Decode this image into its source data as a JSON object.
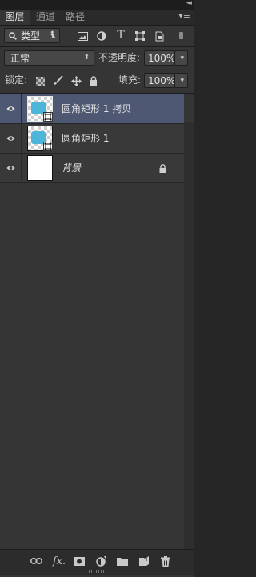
{
  "panel": {
    "tabs": [
      {
        "label": "图层",
        "active": true
      },
      {
        "label": "通道",
        "active": false
      },
      {
        "label": "路径",
        "active": false
      }
    ],
    "collapse_glyph": "◂◂",
    "menu_glyph": "▾≡"
  },
  "filter": {
    "kind_label": "类型",
    "icons": [
      "image-filter-icon",
      "adjustment-filter-icon",
      "text-filter-icon",
      "shape-filter-icon",
      "smart-object-filter-icon"
    ],
    "text_icon_glyph": "T"
  },
  "blend": {
    "mode": "正常",
    "opacity_label": "不透明度:",
    "opacity_value": "100%"
  },
  "lock": {
    "label": "锁定:",
    "fill_label": "填充:",
    "fill_value": "100%"
  },
  "layers": [
    {
      "name": "圆角矩形 1 拷贝",
      "type": "shape",
      "selected": true,
      "visible": true,
      "locked": false
    },
    {
      "name": "圆角矩形 1",
      "type": "shape",
      "selected": false,
      "visible": true,
      "locked": false
    },
    {
      "name": "背景",
      "type": "background",
      "selected": false,
      "visible": true,
      "locked": true
    }
  ],
  "bottom_icons": [
    "link-layers-icon",
    "fx-icon",
    "add-mask-icon",
    "adjustment-layer-icon",
    "new-group-icon",
    "new-layer-icon",
    "delete-layer-icon"
  ],
  "fx_glyph": "fx.",
  "colors": {
    "panel_bg": "#353535",
    "selected_row": "#4e5873",
    "shape_fill": "#4db5da"
  }
}
